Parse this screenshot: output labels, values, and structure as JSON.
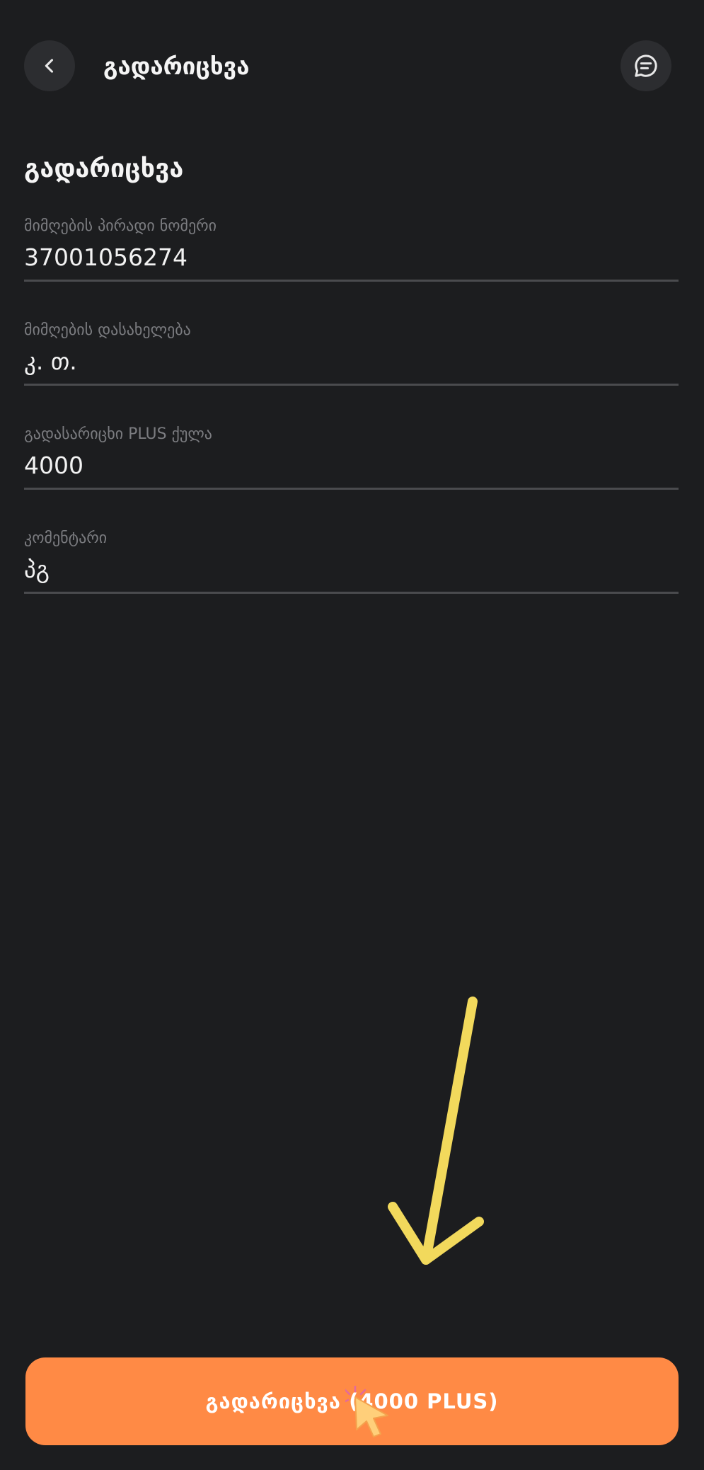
{
  "header": {
    "title": "გადარიცხვა",
    "back_icon": "chevron-left-icon",
    "chat_icon": "chat-bubble-icon"
  },
  "page": {
    "title": "გადარიცხვა"
  },
  "fields": [
    {
      "label": "მიმღების პირადი ნომერი",
      "value": "37001056274"
    },
    {
      "label": "მიმღების დასახელება",
      "value": "კ. თ."
    },
    {
      "label": "გადასარიცხი PLUS ქულა",
      "value": "4000"
    },
    {
      "label": "კომენტარი",
      "value": "პგ"
    }
  ],
  "submit": {
    "label": "გადარიცხვა (4000 PLUS)"
  },
  "colors": {
    "background": "#1c1d1f",
    "accent": "#ff8a45",
    "annotation_arrow": "#f2d95c"
  }
}
